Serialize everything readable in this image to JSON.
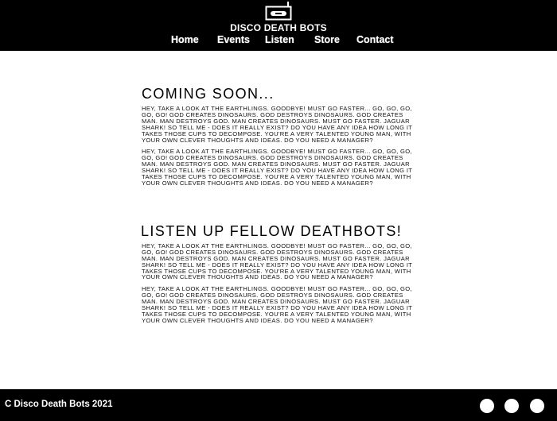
{
  "header": {
    "logo_icon": "cassette-tape-icon",
    "site_title": "DISCO DEATH BOTS",
    "nav": [
      "Home",
      "Events",
      "Listen",
      "Store",
      "Contact"
    ]
  },
  "sections": [
    {
      "heading": "COMING SOON...",
      "paragraphs": [
        "Hey, take a look at the earthlings. Goodbye! Must go faster... go, go, go, go, go! God creates dinosaurs. God destroys dinosaurs. God creates Man. Man destroys God. Man creates Dinosaurs. Must go faster. Jaguar shark! So tell me - does it really exist? Do you have any idea how long it takes those cups to decompose. You're a very talented young man, with your own clever thoughts and ideas. Do you need a manager?",
        "Hey, take a look at the earthlings. Goodbye! Must go faster... go, go, go, go, go! God creates dinosaurs. God destroys dinosaurs. God creates Man. Man destroys God. Man creates Dinosaurs. Must go faster. Jaguar shark! So tell me - does it really exist? Do you have any idea how long it takes those cups to decompose. You're a very talented young man, with your own clever thoughts and ideas. Do you need a manager?"
      ]
    },
    {
      "heading": "LISTEN UP FELLOW DEATHBOTS!",
      "paragraphs": [
        "Hey, take a look at the earthlings. Goodbye! Must go faster... go, go, go, go, go! God creates dinosaurs. God destroys dinosaurs. God creates Man. Man destroys God. Man creates Dinosaurs. Must go faster. Jaguar shark! So tell me - does it really exist? Do you have any idea how long it takes those cups to decompose. You're a very talented young man, with your own clever thoughts and ideas. Do you need a manager?",
        "Hey, take a look at the earthlings. Goodbye! Must go faster... go, go, go, go, go! God creates dinosaurs. God destroys dinosaurs. God creates Man. Man destroys God. Man creates Dinosaurs. Must go faster. Jaguar shark! So tell me - does it really exist? Do you have any idea how long it takes those cups to decompose. You're a very talented young man, with your own clever thoughts and ideas. Do you need a manager?"
      ]
    }
  ],
  "footer": {
    "copyright": "C Disco Death Bots 2021",
    "social_icons": [
      "social-circle-icon",
      "social-circle-icon",
      "social-circle-icon"
    ]
  },
  "colors": {
    "bar_background": "#000000",
    "page_background": "#ffffff",
    "text_light": "#ffffff",
    "text_dark": "#000000"
  }
}
